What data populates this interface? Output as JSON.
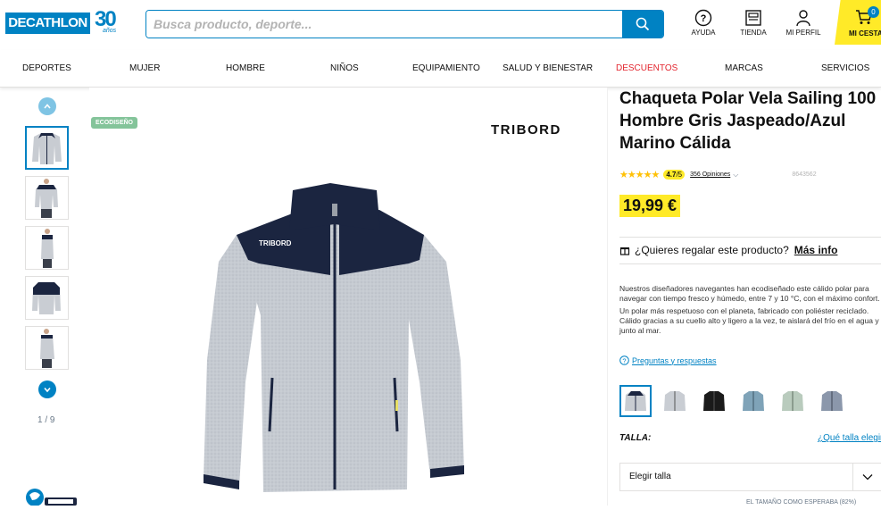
{
  "header": {
    "logo": "DECATHLON",
    "anniversary": "30",
    "anniversary_sub": "años",
    "search_placeholder": "Busca producto, deporte...",
    "icons": [
      {
        "name": "help-icon",
        "label": "AYUDA"
      },
      {
        "name": "store-icon",
        "label": "TIENDA"
      },
      {
        "name": "user-icon",
        "label": "MI PERFIL"
      }
    ],
    "cart": {
      "label": "MI CESTA",
      "count": "0"
    }
  },
  "nav": [
    "DEPORTES",
    "MUJER",
    "HOMBRE",
    "NIÑOS",
    "EQUIPAMIENTO",
    "SALUD Y BIENESTAR",
    "DESCUENTOS",
    "MARCAS",
    "SERVICIOS"
  ],
  "gallery": {
    "counter": "1 / 9",
    "eco_badge": "ECODISEÑO",
    "brand": "TRIBORD",
    "jacket_logo": "TRIBORD"
  },
  "product": {
    "title": "Chaqueta Polar Vela Sailing 100 Hombre Gris Jaspeado/Azul Marino Cálida",
    "rating": "4.7",
    "rating_max": "/5",
    "reviews": "356 Opiniones",
    "ref": "8643562",
    "price": "19,99 €",
    "gift_text": "¿Quieres regalar este producto?",
    "gift_more": "Más info",
    "desc1": "Nuestros diseñadores navegantes han ecodiseñado este cálido polar para navegar con tiempo fresco y húmedo, entre 7 y 10 °C, con el máximo confort.",
    "desc2": "Un polar más respetuoso con el planeta, fabricado con poliéster reciclado. Cálido gracias a su cuello alto y ligero a la vez, te aislará del frío en el agua y junto al mar.",
    "qa": "Preguntas y respuestas",
    "swatch_colors": [
      "#c8ccd2",
      "#c9cdd3",
      "#1a1a1a",
      "#7fa3b8",
      "#b9cbbd",
      "#8b97ab"
    ],
    "size_label": "TALLA:",
    "size_guide": "¿Qué talla elegir?",
    "size_select": "Elegir talla",
    "fit_note": "EL TAMAÑO COMO ESPERABA (82%)"
  },
  "colors": {
    "brand_blue": "#0082c3",
    "yellow": "#ffea28",
    "discount_red": "#e3262f"
  }
}
